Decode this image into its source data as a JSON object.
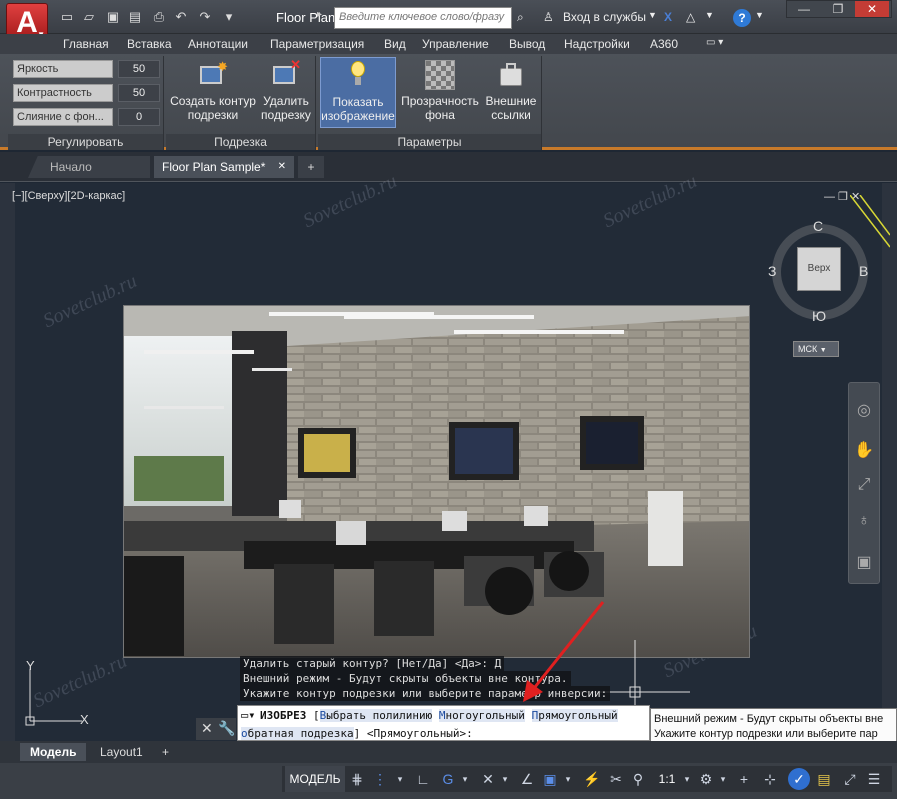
{
  "app": {
    "logo": "A",
    "title": "Floor Plan S",
    "title_caret": "▸",
    "search_placeholder": "Введите ключевое слово/фразу",
    "signin": "Вход в службы",
    "help": "?"
  },
  "window_controls": {
    "minimize": "—",
    "restore": "❐",
    "close": "✕"
  },
  "menu": [
    "Главная",
    "Вставка",
    "Аннотации",
    "Параметризация",
    "Вид",
    "Управление",
    "Вывод",
    "Надстройки",
    "A360"
  ],
  "ribbon": {
    "adjust": {
      "title": "Регулировать",
      "rows": [
        {
          "label": "Яркость",
          "value": "50"
        },
        {
          "label": "Контрастность",
          "value": "50"
        },
        {
          "label": "Слияние с фон...",
          "value": "0"
        }
      ]
    },
    "clip": {
      "title": "Подрезка",
      "buttons": [
        "Создать контур подрезки",
        "Удалить подрезку"
      ]
    },
    "options": {
      "title": "Параметры",
      "buttons": [
        "Показать изображение",
        "Прозрачность фона",
        "Внешние ссылки"
      ]
    }
  },
  "file_tabs": {
    "start": "Начало",
    "active": "Floor Plan Sample*",
    "close": "✕",
    "add": "+"
  },
  "viewport": {
    "label": "[−][Сверху][2D-каркас]",
    "controls": "— ❐ ✕"
  },
  "viewcube": {
    "face": "Верх",
    "n": "С",
    "s": "Ю",
    "w": "З",
    "e": "В",
    "ucs": "МСК"
  },
  "ucs_axes": {
    "x": "X",
    "y": "Y"
  },
  "command_history": [
    "Удалить старый контур? [Нет/Да] <Да>: Д",
    "Внешний режим - Будут скрыты объекты вне контура.",
    "Укажите контур подрезки или выберите параметр инверсии:"
  ],
  "command_line": {
    "command": "ИЗОБРЕЗ",
    "open": " [",
    "opt1_key": "В",
    "opt1": "ыбрать полилинию",
    "opt2_key": "М",
    "opt2": "ногоугольный",
    "opt3_key": "П",
    "opt3": "рямоугольный",
    "opt4_key": "о",
    "opt4": "братная подрезка",
    "close": "]",
    "prompt": " <Прямоугольный>:"
  },
  "tooltip": {
    "line1": "Внешний режим - Будут скрыты объекты вне",
    "line2": "Укажите контур подрезки или выберите пар"
  },
  "layout_tabs": {
    "model": "Модель",
    "layout1": "Layout1",
    "add": "+"
  },
  "status": {
    "model": "МОДЕЛЬ",
    "scale": "1:1"
  },
  "watermark": "Sovetclub.ru"
}
